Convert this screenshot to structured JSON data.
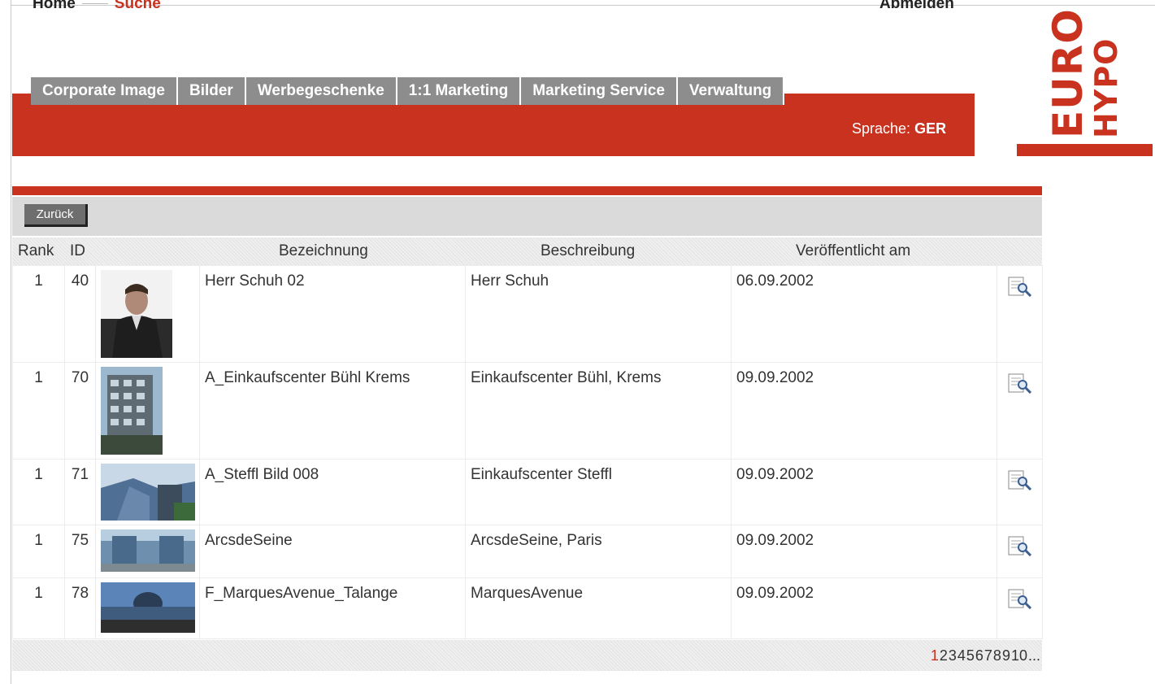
{
  "header": {
    "home": "Home",
    "search": "Suche",
    "logout": "Abmelden",
    "language_label": "Sprache:",
    "language_value": "GER",
    "logo_line1": "EURO",
    "logo_line2": "HYPO"
  },
  "tabs": [
    {
      "label": "Corporate Image"
    },
    {
      "label": "Bilder"
    },
    {
      "label": "Werbegeschenke"
    },
    {
      "label": "1:1 Marketing"
    },
    {
      "label": "Marketing Service"
    },
    {
      "label": "Verwaltung"
    }
  ],
  "toolbar": {
    "back_label": "Zurück"
  },
  "table": {
    "columns": {
      "rank": "Rank",
      "id": "ID",
      "name": "Bezeichnung",
      "description": "Beschreibung",
      "published": "Veröffentlicht am"
    },
    "rows": [
      {
        "rank": "1",
        "id": "40",
        "name": "Herr Schuh 02",
        "description": "Herr Schuh",
        "published": "06.09.2002"
      },
      {
        "rank": "1",
        "id": "70",
        "name": "A_Einkaufscenter Bühl Krems",
        "description": "Einkaufscenter Bühl, Krems",
        "published": "09.09.2002"
      },
      {
        "rank": "1",
        "id": "71",
        "name": "A_Steffl Bild 008",
        "description": "Einkaufscenter Steffl",
        "published": "09.09.2002"
      },
      {
        "rank": "1",
        "id": "75",
        "name": "ArcsdeSeine",
        "description": "ArcsdeSeine, Paris",
        "published": "09.09.2002"
      },
      {
        "rank": "1",
        "id": "78",
        "name": "F_MarquesAvenue_Talange",
        "description": "MarquesAvenue",
        "published": "09.09.2002"
      }
    ]
  },
  "pagination": {
    "pages": [
      "1",
      "2",
      "3",
      "4",
      "5",
      "6",
      "7",
      "8",
      "9",
      "10"
    ],
    "current": "1",
    "more": "..."
  },
  "colors": {
    "brand_red": "#c8321f",
    "tab_gray": "#8d8d8d",
    "toolbar_gray": "#dadada"
  },
  "icons": [
    "view-detail-icon"
  ]
}
